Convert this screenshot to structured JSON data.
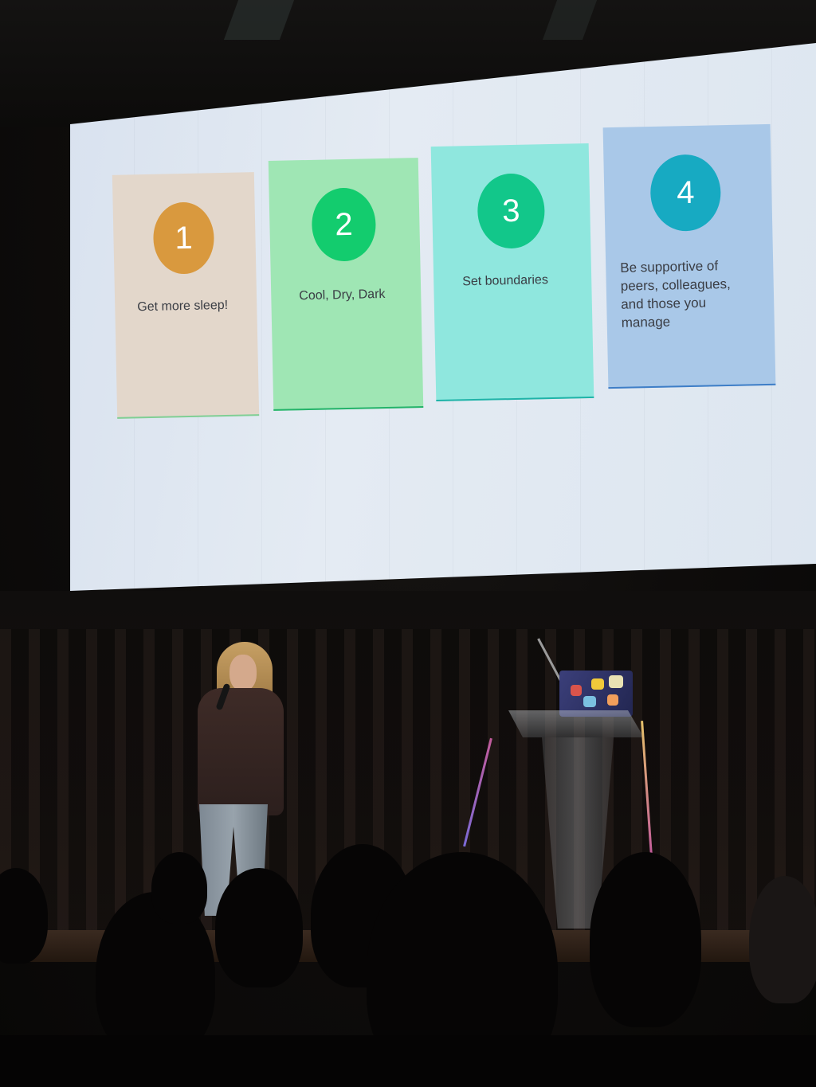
{
  "slide": {
    "cards": [
      {
        "number": "1",
        "text": "Get more sleep!",
        "card_color": "#e3d7cb",
        "badge_color": "#d9993e",
        "border_color": "#7fcf95"
      },
      {
        "number": "2",
        "text": "Cool, Dry, Dark",
        "card_color": "#9fe6b4",
        "badge_color": "#13cc6e",
        "border_color": "#24b36a"
      },
      {
        "number": "3",
        "text": "Set boundaries",
        "card_color": "#8fe7de",
        "badge_color": "#12c78a",
        "border_color": "#1fb3a8"
      },
      {
        "number": "4",
        "text": "Be supportive of peers, colleagues, and those you manage",
        "card_color": "#a9c8e8",
        "badge_color": "#17aac2",
        "border_color": "#3e7ec7"
      }
    ]
  }
}
